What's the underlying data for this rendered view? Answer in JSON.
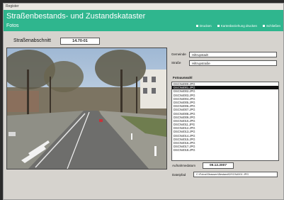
{
  "window": {
    "title": "Register"
  },
  "header": {
    "app_title": "Straßenbestands- und Zustandskataster",
    "section": "Fotos",
    "links": [
      "Drucken",
      "Kartenbeziehung drucken",
      "Schließen"
    ]
  },
  "strassenabschnitt": {
    "label": "Straßenabschnitt",
    "value": "14.70-01"
  },
  "fields": {
    "gemeinde": {
      "label": "Gemeinde",
      "value": "Hiltrupstadt"
    },
    "strasse": {
      "label": "Straße",
      "value": "Hiltrupstraße"
    }
  },
  "fotoauswahl": {
    "label": "Fotoauswahl",
    "selected_index": 1,
    "items": [
      "DSCN4000.JPG",
      "DSCN4001.JPG",
      "DSCN4002.JPG",
      "DSCN4003.JPG",
      "DSCN4004.JPG",
      "DSCN4005.JPG",
      "DSCN4006.JPG",
      "DSCN4007.JPG",
      "DSCN4008.JPG",
      "DSCN4009.JPG",
      "DSCN4010.JPG",
      "DSCN4011.JPG",
      "DSCN4012.JPG",
      "DSCN4013.JPG",
      "DSCN4014.JPG",
      "DSCN4015.JPG",
      "DSCN4016.JPG",
      "DSCN4017.JPG",
      "DSCN4018.JPG"
    ]
  },
  "aufnahmedatum": {
    "label": "Aufnahmedatum",
    "value": "09.12.2007"
  },
  "dateipfad": {
    "label": "Dateipfad",
    "value": "C:\\Fotos\\Strassen\\Bestand\\DSCN4001.JPG"
  },
  "colors": {
    "accent": "#2fb68e",
    "panel": "#d6d3ce"
  },
  "icons": {
    "photo": "road-photo",
    "link_bullet": "square-bullet-icon"
  }
}
